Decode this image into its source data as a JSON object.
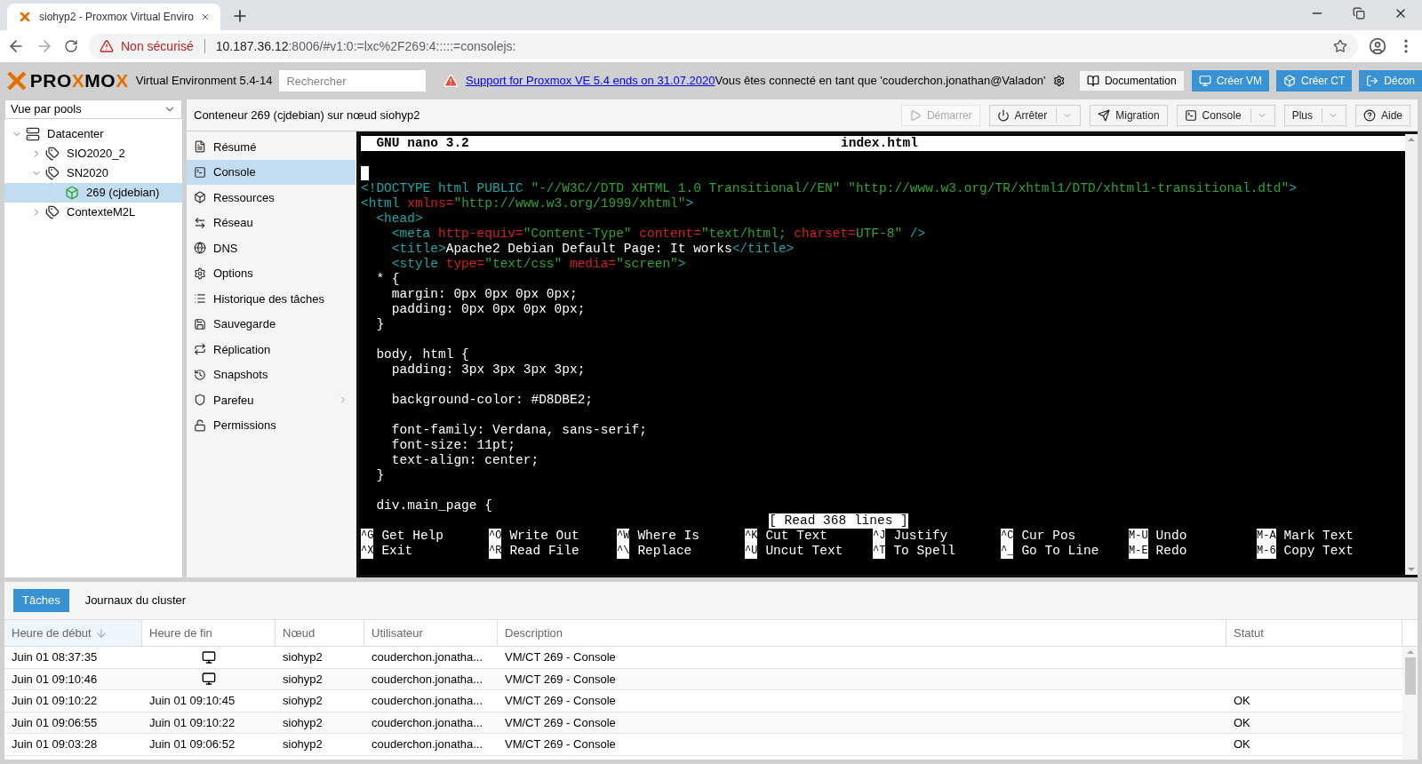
{
  "browser": {
    "tab_title": "siohyp2 - Proxmox Virtual Enviro",
    "security": "Non sécurisé",
    "url_host": "10.187.36.12",
    "url_rest": ":8006/#v1:0:=lxc%2F269:4:::::=consolejs:"
  },
  "header": {
    "logo": [
      {
        "text": "PRO",
        "kind": "plain"
      },
      {
        "text": "X",
        "kind": "accent"
      },
      {
        "text": "MO",
        "kind": "plain"
      },
      {
        "text": "X",
        "kind": "accent"
      }
    ],
    "version": "Virtual Environment 5.4-14",
    "search_placeholder": "Rechercher",
    "support_link": "Support for Proxmox VE 5.4 ends on 31.07.2020",
    "login_text": "Vous êtes connecté en tant que 'couderchon.jonathan@Valadon'",
    "buttons": [
      {
        "label": "Documentation",
        "kind": "plain"
      },
      {
        "label": "Créer VM",
        "kind": "vm"
      },
      {
        "label": "Créer CT",
        "kind": "ct"
      },
      {
        "label": "Décon",
        "kind": "logout"
      }
    ]
  },
  "view_selector": "Vue par pools",
  "tree": [
    {
      "label": "Datacenter",
      "kind": "datacenter",
      "expanded": true,
      "selected": false,
      "children": [
        {
          "label": "SIO2020_2",
          "kind": "pool",
          "expanded": false,
          "selected": false
        },
        {
          "label": "SN2020",
          "kind": "pool",
          "expanded": true,
          "selected": false,
          "children": [
            {
              "label": "269 (cjdebian)",
              "kind": "container",
              "selected": true
            }
          ]
        },
        {
          "label": "ContexteM2L",
          "kind": "pool",
          "expanded": false,
          "selected": false
        }
      ]
    }
  ],
  "content_title": "Conteneur 269 (cjdebian) sur nœud siohyp2",
  "toolbar": [
    {
      "label": "Démarrer",
      "kind": "start",
      "disabled": true,
      "dropdown": false
    },
    {
      "label": "Arrêter",
      "kind": "stop",
      "disabled": false,
      "dropdown": true
    },
    {
      "label": "Migration",
      "kind": "migrate",
      "disabled": false,
      "dropdown": false
    },
    {
      "label": "Console",
      "kind": "console",
      "disabled": false,
      "dropdown": true
    },
    {
      "label": "Plus",
      "kind": "more",
      "disabled": false,
      "dropdown": true
    },
    {
      "label": "Aide",
      "kind": "help",
      "disabled": false,
      "dropdown": false
    }
  ],
  "menu": [
    {
      "label": "Résumé",
      "selected": false,
      "has_submenu": false
    },
    {
      "label": "Console",
      "selected": true,
      "has_submenu": false
    },
    {
      "label": "Ressources",
      "selected": false,
      "has_submenu": false
    },
    {
      "label": "Réseau",
      "selected": false,
      "has_submenu": false
    },
    {
      "label": "DNS",
      "selected": false,
      "has_submenu": false
    },
    {
      "label": "Options",
      "selected": false,
      "has_submenu": false
    },
    {
      "label": "Historique des tâches",
      "selected": false,
      "has_submenu": false
    },
    {
      "label": "Sauvegarde",
      "selected": false,
      "has_submenu": false
    },
    {
      "label": "Réplication",
      "selected": false,
      "has_submenu": false
    },
    {
      "label": "Snapshots",
      "selected": false,
      "has_submenu": false
    },
    {
      "label": "Parefeu",
      "selected": false,
      "has_submenu": true
    },
    {
      "label": "Permissions",
      "selected": false,
      "has_submenu": false
    }
  ],
  "terminal": {
    "app": "GNU nano 3.2",
    "file": "index.html",
    "cursor": true,
    "lines": [
      {
        "segments": [
          {
            "kind": "tag",
            "text": "<!DOCTYPE html PUBLIC "
          },
          {
            "kind": "str",
            "text": "\"-//W3C//DTD XHTML 1.0 Transitional//EN\" \"http://www.w3.org/TR/xhtml1/DTD/xhtml1-transitional.dtd\""
          },
          {
            "kind": "tag",
            "text": ">"
          }
        ]
      },
      {
        "segments": [
          {
            "kind": "tag",
            "text": "<html "
          },
          {
            "kind": "attr",
            "text": "xmlns="
          },
          {
            "kind": "str",
            "text": "\"http://www.w3.org/1999/xhtml\""
          },
          {
            "kind": "tag",
            "text": ">"
          }
        ]
      },
      {
        "segments": [
          {
            "kind": "tag",
            "text": "  <head>"
          }
        ]
      },
      {
        "segments": [
          {
            "kind": "tag",
            "text": "    <meta "
          },
          {
            "kind": "attr",
            "text": "http-equiv="
          },
          {
            "kind": "str",
            "text": "\"Content-Type\" "
          },
          {
            "kind": "attr",
            "text": "content="
          },
          {
            "kind": "str",
            "text": "\"text/html; "
          },
          {
            "kind": "attr",
            "text": "charset="
          },
          {
            "kind": "str",
            "text": "UTF-8\" "
          },
          {
            "kind": "tag",
            "text": "/>"
          }
        ]
      },
      {
        "segments": [
          {
            "kind": "tag",
            "text": "    <title>"
          },
          {
            "kind": "text",
            "text": "Apache2 Debian Default Page: It works"
          },
          {
            "kind": "tag",
            "text": "</title>"
          }
        ]
      },
      {
        "segments": [
          {
            "kind": "tag",
            "text": "    <style "
          },
          {
            "kind": "attr",
            "text": "type="
          },
          {
            "kind": "str",
            "text": "\"text/css\" "
          },
          {
            "kind": "attr",
            "text": "media="
          },
          {
            "kind": "str",
            "text": "\"screen\""
          },
          {
            "kind": "tag",
            "text": ">"
          }
        ]
      },
      {
        "segments": [
          {
            "kind": "text",
            "text": "  * {"
          }
        ]
      },
      {
        "segments": [
          {
            "kind": "text",
            "text": "    margin: 0px 0px 0px 0px;"
          }
        ]
      },
      {
        "segments": [
          {
            "kind": "text",
            "text": "    padding: 0px 0px 0px 0px;"
          }
        ]
      },
      {
        "segments": [
          {
            "kind": "text",
            "text": "  }"
          }
        ]
      },
      {
        "blank_before": true,
        "segments": [
          {
            "kind": "text",
            "text": "  body, html {"
          }
        ]
      },
      {
        "segments": [
          {
            "kind": "text",
            "text": "    padding: 3px 3px 3px 3px;"
          }
        ]
      },
      {
        "blank_before": true,
        "segments": [
          {
            "kind": "text",
            "text": "    background-color: #D8DBE2;"
          }
        ]
      },
      {
        "blank_before": true,
        "segments": [
          {
            "kind": "text",
            "text": "    font-family: Verdana, sans-serif;"
          }
        ]
      },
      {
        "segments": [
          {
            "kind": "text",
            "text": "    font-size: 11pt;"
          }
        ]
      },
      {
        "segments": [
          {
            "kind": "text",
            "text": "    text-align: center;"
          }
        ]
      },
      {
        "segments": [
          {
            "kind": "text",
            "text": "  }"
          }
        ]
      },
      {
        "blank_before": true,
        "segments": [
          {
            "kind": "text",
            "text": "  div.main_page {"
          }
        ]
      }
    ],
    "status": "[ Read 368 lines ]",
    "shortcuts": [
      [
        {
          "key": "^G",
          "label": "Get Help"
        },
        {
          "key": "^O",
          "label": "Write Out"
        },
        {
          "key": "^W",
          "label": "Where Is"
        },
        {
          "key": "^K",
          "label": "Cut Text"
        },
        {
          "key": "^J",
          "label": "Justify"
        },
        {
          "key": "^C",
          "label": "Cur Pos"
        },
        {
          "key": "M-U",
          "label": "Undo"
        },
        {
          "key": "M-A",
          "label": "Mark Text"
        }
      ],
      [
        {
          "key": "^X",
          "label": "Exit"
        },
        {
          "key": "^R",
          "label": "Read File"
        },
        {
          "key": "^\\",
          "label": "Replace"
        },
        {
          "key": "^U",
          "label": "Uncut Text"
        },
        {
          "key": "^T",
          "label": "To Spell"
        },
        {
          "key": "^_",
          "label": "Go To Line"
        },
        {
          "key": "M-E",
          "label": "Redo"
        },
        {
          "key": "M-6",
          "label": "Copy Text"
        }
      ]
    ]
  },
  "bottom_tabs": [
    {
      "label": "Tâches",
      "selected": true
    },
    {
      "label": "Journaux du cluster",
      "selected": false
    }
  ],
  "tasks": {
    "columns": [
      {
        "label": "Heure de début",
        "sorted": true
      },
      {
        "label": "Heure de fin",
        "sorted": false
      },
      {
        "label": "Nœud",
        "sorted": false
      },
      {
        "label": "Utilisateur",
        "sorted": false
      },
      {
        "label": "Description",
        "sorted": false
      },
      {
        "label": "Statut",
        "sorted": false
      }
    ],
    "rows": [
      {
        "start": "Juin 01 08:37:35",
        "running": true,
        "node": "siohyp2",
        "user": "couderchon.jonatha...",
        "description": "VM/CT 269 - Console"
      },
      {
        "start": "Juin 01 09:10:46",
        "running": true,
        "node": "siohyp2",
        "user": "couderchon.jonatha...",
        "description": "VM/CT 269 - Console"
      },
      {
        "start": "Juin 01 09:10:22",
        "running": false,
        "end": "Juin 01 09:10:45",
        "node": "siohyp2",
        "user": "couderchon.jonatha...",
        "description": "VM/CT 269 - Console",
        "status": "OK"
      },
      {
        "start": "Juin 01 09:06:55",
        "running": false,
        "end": "Juin 01 09:10:22",
        "node": "siohyp2",
        "user": "couderchon.jonatha...",
        "description": "VM/CT 269 - Console",
        "status": "OK"
      },
      {
        "start": "Juin 01 09:03:28",
        "running": false,
        "end": "Juin 01 09:06:52",
        "node": "siohyp2",
        "user": "couderchon.jonatha...",
        "description": "VM/CT 269 - Console",
        "status": "OK"
      }
    ]
  }
}
